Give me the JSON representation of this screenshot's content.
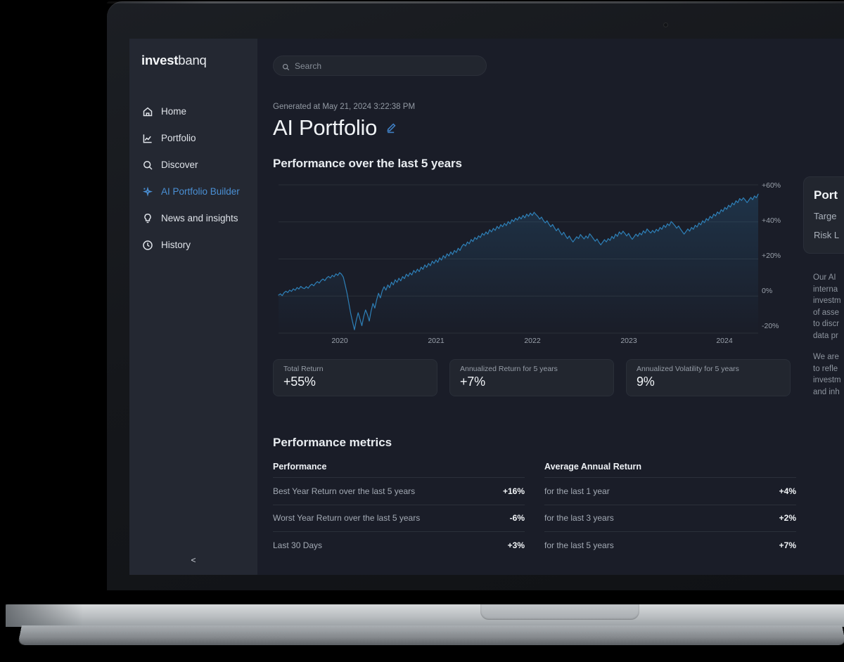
{
  "brand": {
    "bold": "invest",
    "light": "banq"
  },
  "search": {
    "placeholder": "Search",
    "icon": "search-icon"
  },
  "sidebar": {
    "items": [
      {
        "label": "Home",
        "icon": "home-icon",
        "active": false
      },
      {
        "label": "Portfolio",
        "icon": "line-chart-icon",
        "active": false
      },
      {
        "label": "Discover",
        "icon": "search-icon",
        "active": false
      },
      {
        "label": "AI Portfolio Builder",
        "icon": "sparkle-icon",
        "active": true
      },
      {
        "label": "News and insights",
        "icon": "lightbulb-icon",
        "active": false
      },
      {
        "label": "History",
        "icon": "clock-icon",
        "active": false
      }
    ],
    "collapse_label": "<",
    "collapse_icon": "chevron-left-icon"
  },
  "header": {
    "generated_at": "Generated at May 21, 2024 3:22:38 PM",
    "title": "AI Portfolio",
    "edit_icon": "pencil-icon"
  },
  "performance_section": {
    "heading": "Performance over the last 5 years"
  },
  "stats": [
    {
      "label": "Total Return",
      "value": "+55%"
    },
    {
      "label": "Annualized Return for 5 years",
      "value": "+7%"
    },
    {
      "label": "Annualized Volatility for 5 years",
      "value": "9%"
    }
  ],
  "metrics": {
    "heading": "Performance metrics",
    "left": {
      "title": "Performance",
      "rows": [
        {
          "label": "Best Year Return over the last 5 years",
          "value": "+16%"
        },
        {
          "label": "Worst Year Return over the last 5 years",
          "value": "-6%"
        },
        {
          "label": "Last 30 Days",
          "value": "+3%"
        }
      ]
    },
    "right": {
      "title": "Average Annual Return",
      "rows": [
        {
          "label": "for the last 1 year",
          "value": "+4%"
        },
        {
          "label": "for the last 3 years",
          "value": "+2%"
        },
        {
          "label": "for the last 5 years",
          "value": "+7%"
        }
      ]
    }
  },
  "right_panel": {
    "card_title": "Port",
    "card_line1": "Targe",
    "card_line2": "Risk L",
    "paragraph1": [
      "Our AI",
      "interna",
      "investm",
      "of asse",
      "to discr",
      "data pr"
    ],
    "paragraph2": [
      "We are",
      "to refle",
      "investm",
      "and inh"
    ]
  },
  "colors": {
    "accent": "#4a8fd4",
    "chart_line": "#2e80b8",
    "app_bg": "#1a1d28",
    "sidebar_bg": "#242832",
    "card_bg": "#22262f"
  },
  "chart_data": {
    "type": "line",
    "title": "Performance over the last 5 years",
    "xlabel": "",
    "ylabel": "",
    "grid": true,
    "legend": "none",
    "xticks": [
      "2020",
      "2021",
      "2022",
      "2023",
      "2024"
    ],
    "yticks": [
      "+60%",
      "+40%",
      "+20%",
      "0%",
      "-20%"
    ],
    "ylim": [
      -20,
      60
    ],
    "series": [
      {
        "name": "AI Portfolio",
        "color": "#2e80b8",
        "values": [
          0.5,
          1.2,
          0.2,
          1.8,
          2.6,
          1.9,
          3.2,
          2.5,
          3.9,
          3.1,
          4.6,
          3.8,
          5.2,
          4.4,
          4.0,
          5.1,
          4.2,
          5.6,
          6.4,
          5.5,
          6.9,
          7.8,
          7.0,
          8.4,
          9.2,
          8.3,
          9.8,
          10.6,
          9.7,
          11.2,
          10.4,
          12.0,
          11.1,
          12.6,
          11.8,
          10.2,
          6.0,
          1.5,
          -4.0,
          -9.5,
          -14.0,
          -18.2,
          -13.0,
          -9.0,
          -12.5,
          -16.0,
          -11.0,
          -7.5,
          -10.0,
          -13.5,
          -8.0,
          -4.0,
          -6.5,
          -2.0,
          1.5,
          -1.0,
          2.8,
          5.0,
          3.2,
          6.0,
          4.5,
          7.5,
          6.0,
          8.8,
          7.4,
          9.6,
          8.2,
          10.5,
          9.4,
          11.8,
          10.6,
          12.5,
          11.4,
          13.8,
          12.6,
          14.5,
          13.2,
          15.6,
          14.4,
          16.8,
          15.5,
          17.6,
          16.4,
          18.8,
          17.6,
          19.5,
          18.2,
          20.6,
          19.4,
          21.8,
          20.5,
          22.8,
          21.6,
          23.8,
          22.4,
          24.6,
          23.5,
          25.8,
          24.6,
          26.8,
          28.0,
          27.0,
          29.2,
          28.2,
          30.5,
          29.4,
          31.6,
          30.6,
          32.5,
          31.6,
          33.8,
          32.8,
          34.6,
          33.4,
          35.8,
          34.6,
          36.5,
          35.4,
          37.6,
          36.4,
          38.5,
          37.4,
          39.2,
          38.0,
          40.2,
          39.0,
          41.2,
          40.2,
          42.0,
          41.0,
          42.8,
          41.6,
          43.5,
          42.2,
          44.2,
          43.0,
          44.8,
          43.5,
          45.2,
          44.0,
          43.0,
          41.5,
          42.6,
          40.8,
          39.5,
          40.6,
          38.8,
          37.4,
          38.6,
          36.8,
          35.2,
          36.5,
          34.6,
          33.0,
          34.4,
          32.5,
          31.0,
          32.4,
          30.6,
          29.2,
          30.6,
          32.0,
          31.0,
          33.2,
          32.0,
          30.8,
          32.4,
          31.2,
          33.6,
          32.4,
          31.0,
          29.6,
          30.8,
          29.0,
          27.6,
          29.0,
          30.4,
          29.2,
          31.0,
          30.0,
          32.2,
          31.0,
          33.4,
          32.2,
          34.6,
          33.4,
          35.0,
          33.8,
          32.4,
          33.8,
          32.0,
          30.6,
          32.0,
          33.4,
          32.2,
          34.0,
          33.0,
          35.2,
          34.0,
          36.2,
          35.0,
          34.0,
          35.4,
          34.2,
          36.0,
          35.0,
          37.0,
          36.0,
          38.2,
          37.0,
          39.0,
          38.0,
          40.2,
          39.2,
          38.0,
          36.6,
          37.8,
          36.2,
          34.8,
          33.4,
          34.8,
          36.2,
          35.0,
          37.0,
          36.0,
          38.2,
          37.2,
          39.4,
          38.4,
          40.6,
          39.6,
          41.8,
          40.8,
          43.0,
          42.0,
          44.2,
          43.2,
          45.4,
          44.4,
          46.6,
          45.6,
          47.8,
          46.8,
          49.0,
          48.0,
          50.2,
          49.2,
          51.4,
          50.4,
          52.6,
          51.6,
          53.0,
          51.8,
          50.4,
          51.8,
          53.2,
          52.0,
          54.0,
          53.0,
          55.0
        ]
      }
    ]
  }
}
